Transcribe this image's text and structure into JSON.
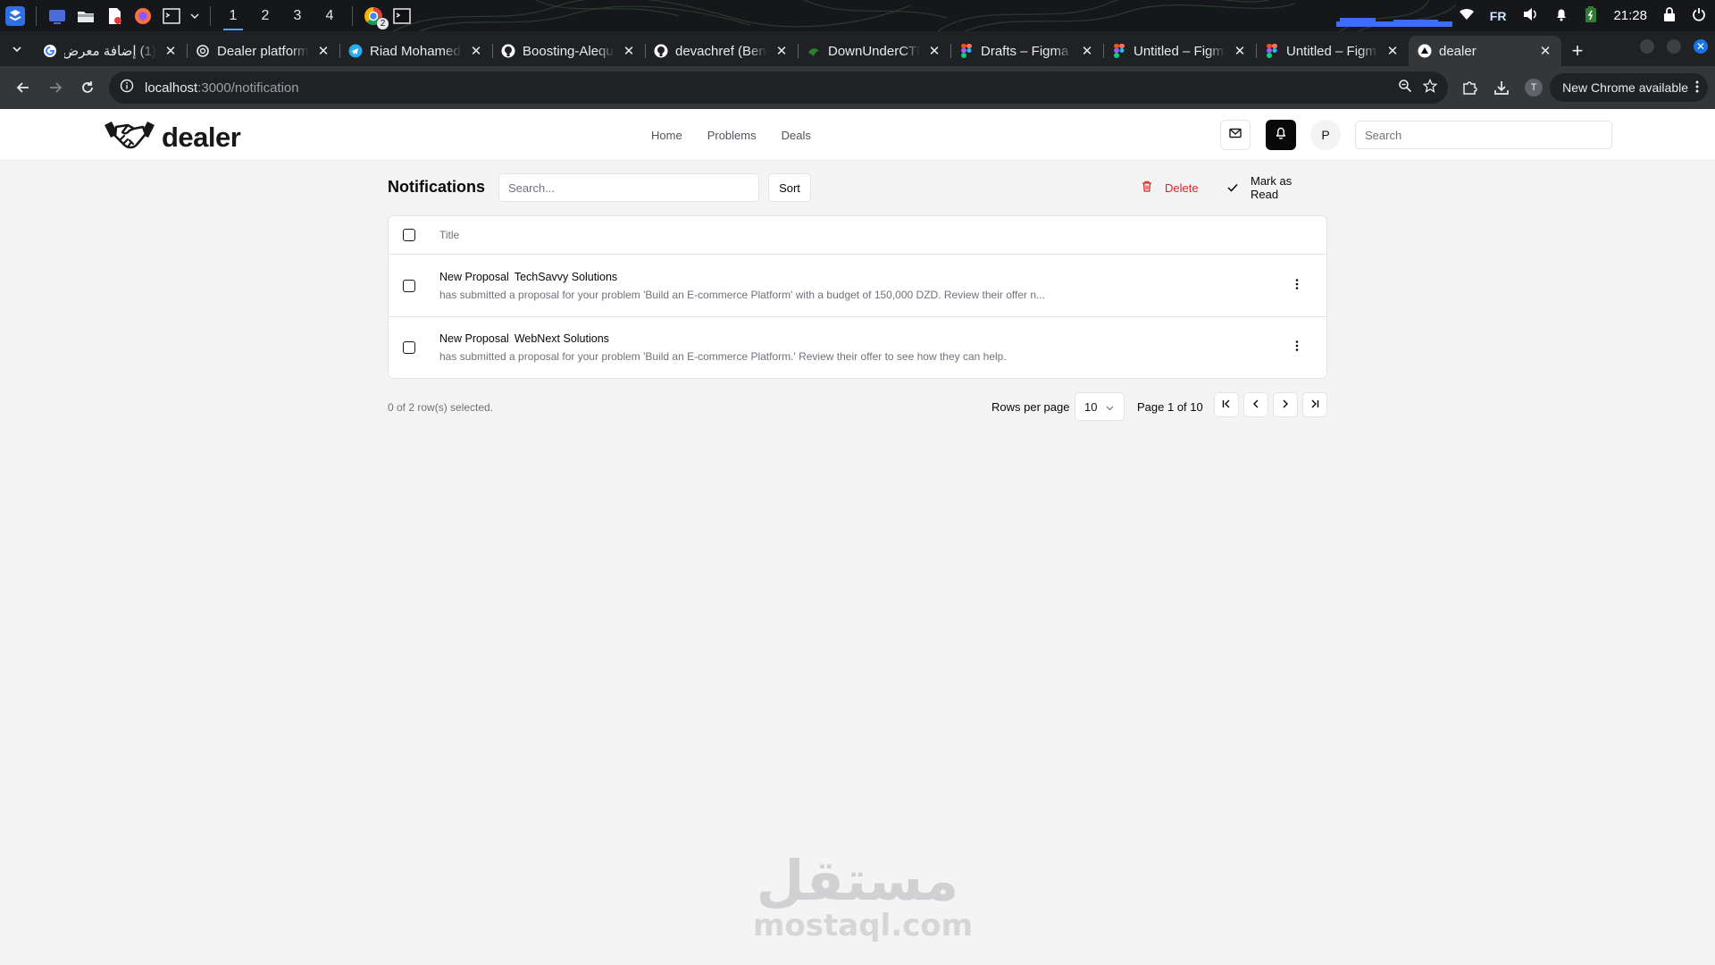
{
  "os_panel": {
    "workspaces": [
      "1",
      "2",
      "3",
      "4"
    ],
    "active_workspace": "1",
    "lang": "FR",
    "clock": "21:28",
    "chrome_badge": "2"
  },
  "browser": {
    "tabs": [
      {
        "title": "(1) إضافة معرض",
        "icon": "google-icon"
      },
      {
        "title": "Dealer platform",
        "icon": "chatgpt-icon"
      },
      {
        "title": "Riad Mohamed",
        "icon": "telegram-icon"
      },
      {
        "title": "Boosting-Alequ",
        "icon": "github-icon"
      },
      {
        "title": "devachref (Ben",
        "icon": "github-icon"
      },
      {
        "title": "DownUnderCTF",
        "icon": "ctf-icon"
      },
      {
        "title": "Drafts – Figma",
        "icon": "figma-icon"
      },
      {
        "title": "Untitled – Figma",
        "icon": "figma-icon"
      },
      {
        "title": "Untitled – Figma",
        "icon": "figma-icon"
      },
      {
        "title": "dealer",
        "icon": "vercel-icon",
        "active": true
      }
    ],
    "url_host": "localhost",
    "url_path": ":3000/notification",
    "profile_initial": "T",
    "update_label": "New Chrome available"
  },
  "header": {
    "brand": "dealer",
    "nav": [
      "Home",
      "Problems",
      "Deals"
    ],
    "avatar_initial": "P",
    "search_placeholder": "Search"
  },
  "notifications": {
    "title": "Notifications",
    "search_placeholder": "Search...",
    "sort_label": "Sort",
    "delete_label": "Delete",
    "mark_read_label": "Mark as Read",
    "column_title": "Title",
    "rows": [
      {
        "type": "New Proposal",
        "company": "TechSavvy Solutions",
        "description": "has submitted a proposal for your problem 'Build an E-commerce Platform' with a budget of 150,000 DZD. Review their offer n..."
      },
      {
        "type": "New Proposal",
        "company": "WebNext Solutions",
        "description": "has submitted a proposal for your problem 'Build an E-commerce Platform.' Review their offer to see how they can help."
      }
    ],
    "selection_text": "0 of 2 row(s) selected.",
    "rows_per_page_label": "Rows per page",
    "rows_per_page_value": "10",
    "page_info": "Page 1 of 10"
  },
  "watermark": {
    "arabic": "مستقل",
    "latin": "mostaql.com"
  },
  "colors": {
    "accent_dark": "#09090b",
    "danger": "#dc2626",
    "muted": "#71717a",
    "border": "#e4e4e7",
    "page_bg": "#f4f4f5"
  }
}
